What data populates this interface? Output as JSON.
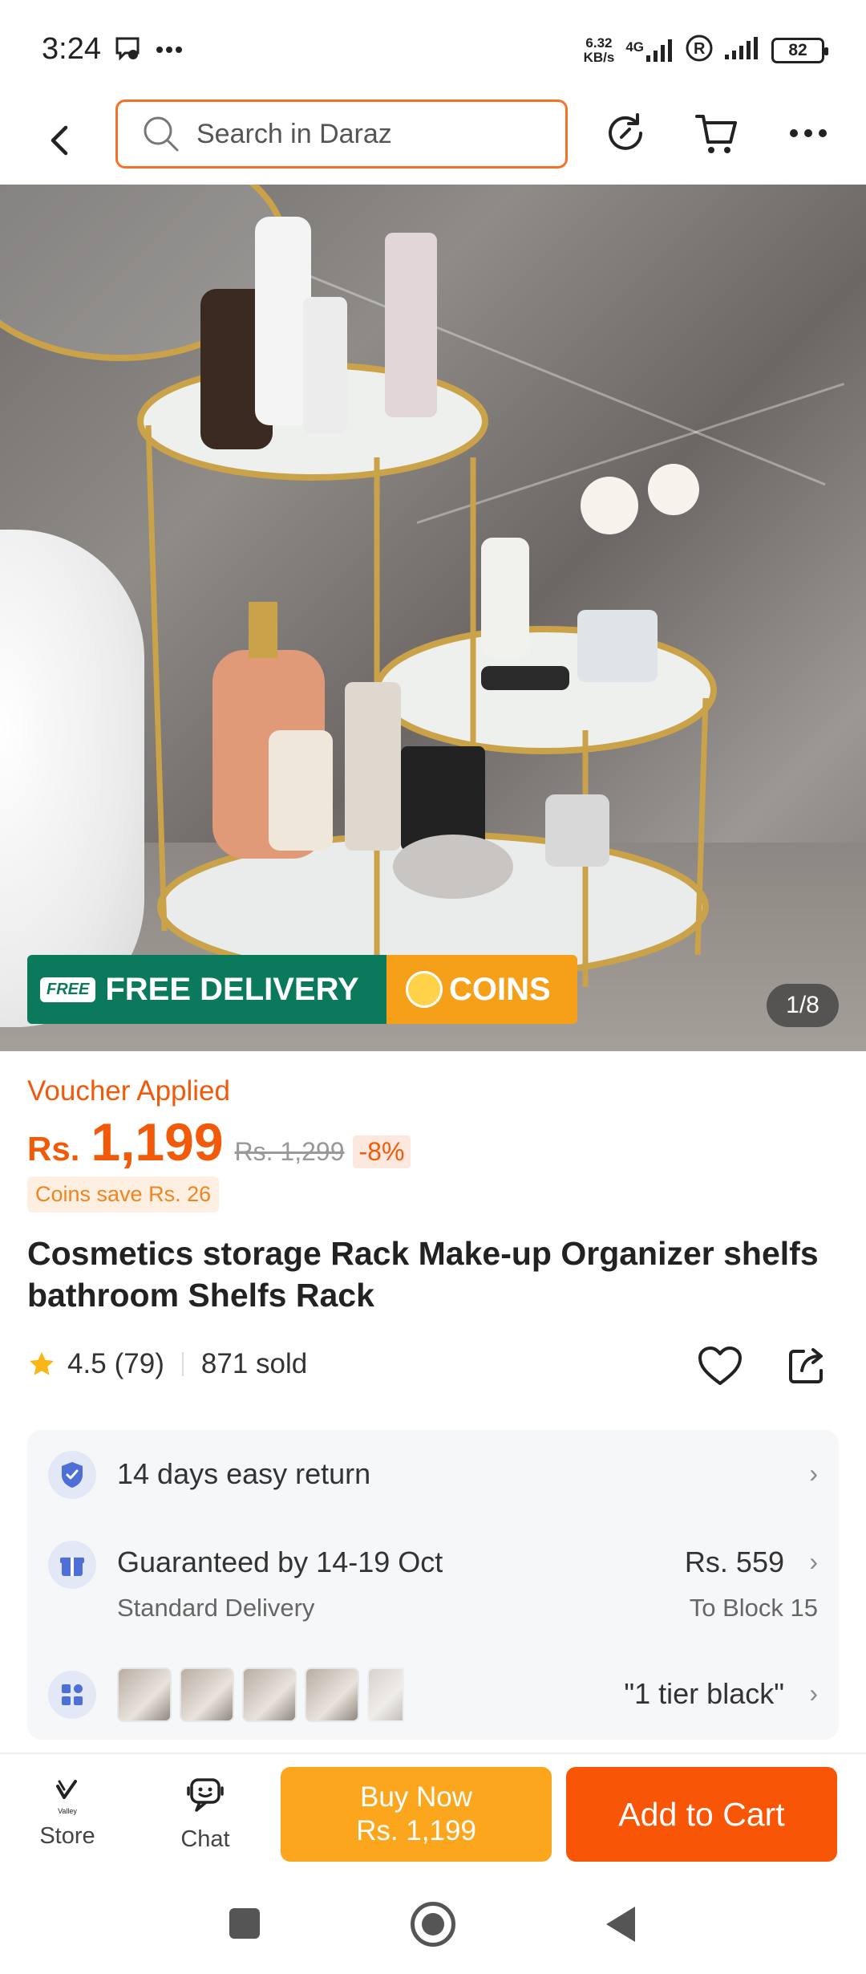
{
  "status_bar": {
    "time": "3:24",
    "netspeed_value": "6.32",
    "netspeed_unit": "KB/s",
    "network_type": "4G",
    "battery": "82"
  },
  "topnav": {
    "search_placeholder": "Search in Daraz"
  },
  "gallery": {
    "badge_free_truck": "FREE",
    "badge_free": "FREE DELIVERY",
    "badge_coins": "COINS",
    "counter": "1/8"
  },
  "pricing": {
    "voucher": "Voucher Applied",
    "currency": "Rs.",
    "price": "1,199",
    "old_price": "Rs. 1,299",
    "discount": "-8%",
    "coins_save": "Coins save Rs. 26"
  },
  "product": {
    "title": "Cosmetics storage Rack Make-up Organizer shelfs bathroom Shelfs Rack",
    "rating": "4.5",
    "reviews": "(79)",
    "sold": "871 sold"
  },
  "info": {
    "returns": "14 days easy return",
    "delivery_title": "Guaranteed by 14-19 Oct",
    "delivery_type": "Standard Delivery",
    "delivery_fee": "Rs. 559",
    "delivery_location": "To Block 15",
    "variant_selected": "\"1 tier black\""
  },
  "bottom_bar": {
    "store_label": "Store",
    "store_logo_text": "Valley",
    "chat_label": "Chat",
    "buy_now_label": "Buy Now",
    "buy_now_price": "Rs. 1,199",
    "add_to_cart_label": "Add to Cart"
  },
  "colors": {
    "brand_orange": "#f85606",
    "buy_now_yellow": "#fca61e",
    "free_delivery_green": "#0b7a5c",
    "price_orange": "#f25a0a"
  }
}
